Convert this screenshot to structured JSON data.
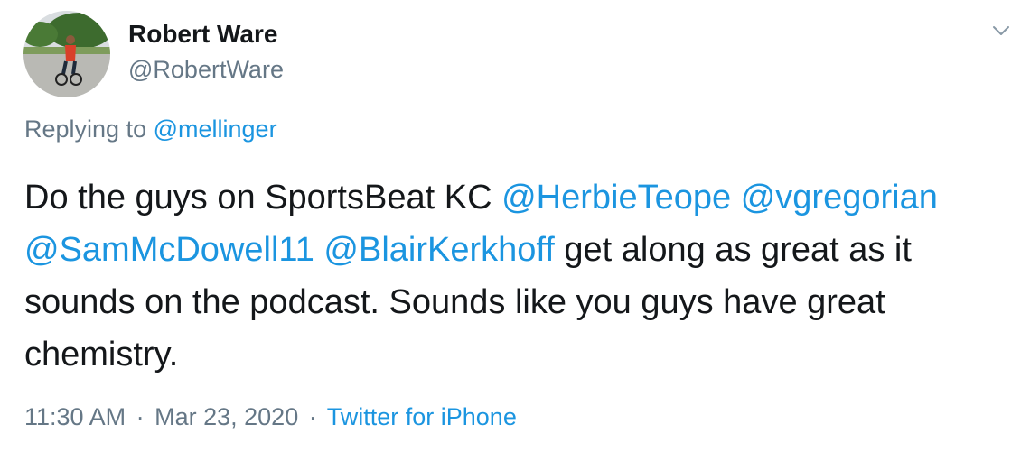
{
  "author": {
    "display_name": "Robert Ware",
    "handle": "@RobertWare",
    "avatar_icon": "avatar-cyclist-photo"
  },
  "menu_icon": "chevron-down-icon",
  "reply": {
    "prefix": "Replying to",
    "to": "@mellinger"
  },
  "tweet": {
    "segments": [
      {
        "type": "text",
        "value": "Do the guys on SportsBeat KC "
      },
      {
        "type": "mention",
        "value": "@HerbieTeope"
      },
      {
        "type": "text",
        "value": " "
      },
      {
        "type": "mention",
        "value": "@vgregorian"
      },
      {
        "type": "text",
        "value": " "
      },
      {
        "type": "mention",
        "value": "@SamMcDowell11"
      },
      {
        "type": "text",
        "value": " "
      },
      {
        "type": "mention",
        "value": "@BlairKerkhoff"
      },
      {
        "type": "text",
        "value": " get along as great as it sounds on the podcast.  Sounds like you guys have great chemistry."
      }
    ]
  },
  "meta": {
    "time": "11:30 AM",
    "separator": "·",
    "date": "Mar 23, 2020",
    "source": "Twitter for iPhone"
  },
  "colors": {
    "link": "#1b95e0",
    "secondary_text": "#657786",
    "primary_text": "#14171a"
  }
}
